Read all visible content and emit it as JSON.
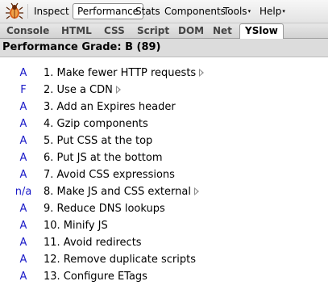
{
  "toolbar": {
    "items": [
      {
        "label": "Inspect",
        "dropdown": false
      },
      {
        "label": "Performance",
        "dropdown": false,
        "active": true
      },
      {
        "label": "Stats",
        "dropdown": false
      },
      {
        "label": "Components",
        "dropdown": false
      },
      {
        "label": "Tools",
        "dropdown": true
      },
      {
        "label": "Help",
        "dropdown": true
      }
    ],
    "dropdown_glyph": "▾",
    "logo_icon": "firebug-icon"
  },
  "tabs": [
    {
      "label": "Console"
    },
    {
      "label": "HTML"
    },
    {
      "label": "CSS"
    },
    {
      "label": "Script"
    },
    {
      "label": "DOM"
    },
    {
      "label": "Net"
    },
    {
      "label": "YSlow",
      "active": true
    }
  ],
  "grade": {
    "label": "Performance Grade:",
    "value": "B (89)"
  },
  "rules": [
    {
      "grade": "A",
      "text": "1. Make fewer HTTP requests",
      "expandable": true
    },
    {
      "grade": "F",
      "text": "2. Use a CDN",
      "expandable": true
    },
    {
      "grade": "A",
      "text": "3. Add an Expires header",
      "expandable": false
    },
    {
      "grade": "A",
      "text": "4. Gzip components",
      "expandable": false
    },
    {
      "grade": "A",
      "text": "5. Put CSS at the top",
      "expandable": false
    },
    {
      "grade": "A",
      "text": "6. Put JS at the bottom",
      "expandable": false
    },
    {
      "grade": "A",
      "text": "7. Avoid CSS expressions",
      "expandable": false
    },
    {
      "grade": "n/a",
      "text": "8. Make JS and CSS external",
      "expandable": true
    },
    {
      "grade": "A",
      "text": "9. Reduce DNS lookups",
      "expandable": false
    },
    {
      "grade": "A",
      "text": "10. Minify JS",
      "expandable": false
    },
    {
      "grade": "A",
      "text": "11. Avoid redirects",
      "expandable": false
    },
    {
      "grade": "A",
      "text": "12. Remove duplicate scripts",
      "expandable": false
    },
    {
      "grade": "A",
      "text": "13. Configure ETags",
      "expandable": false
    }
  ],
  "colors": {
    "grade_text": "#1a1ac8",
    "grade_bar_bg": "#dcdcdc"
  }
}
